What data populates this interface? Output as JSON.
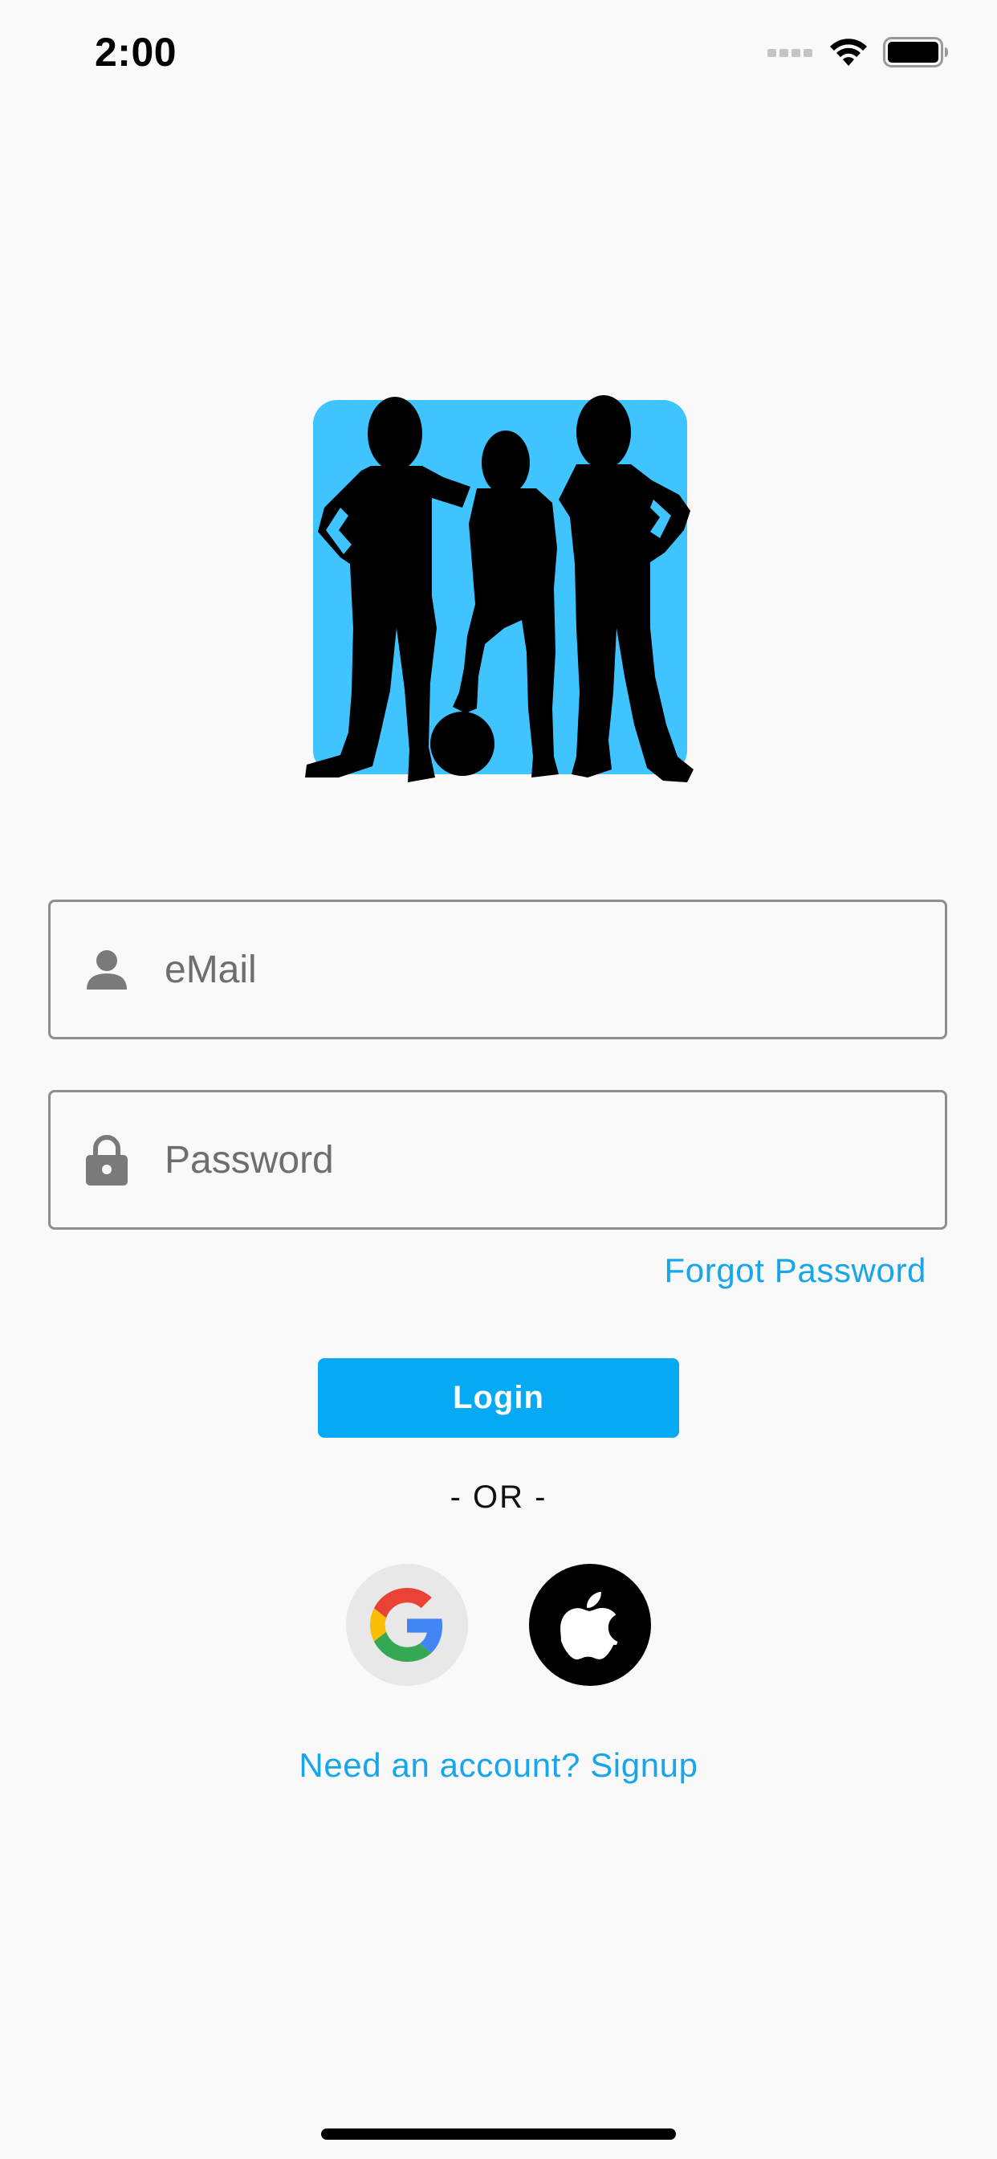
{
  "status_bar": {
    "time": "2:00"
  },
  "logo": {
    "icon": "kids-silhouette-logo",
    "background_color": "#40c4ff"
  },
  "form": {
    "email_placeholder": "eMail",
    "email_value": "",
    "password_placeholder": "Password",
    "password_value": "",
    "forgot_password_label": "Forgot Password",
    "login_label": "Login",
    "or_label": "- OR -",
    "signup_label": "Need an account? Signup"
  },
  "social": {
    "google_icon": "google-icon",
    "apple_icon": "apple-icon"
  },
  "colors": {
    "accent": "#06a9f4",
    "link": "#18a5ea",
    "field_border": "#8e8e8e"
  }
}
